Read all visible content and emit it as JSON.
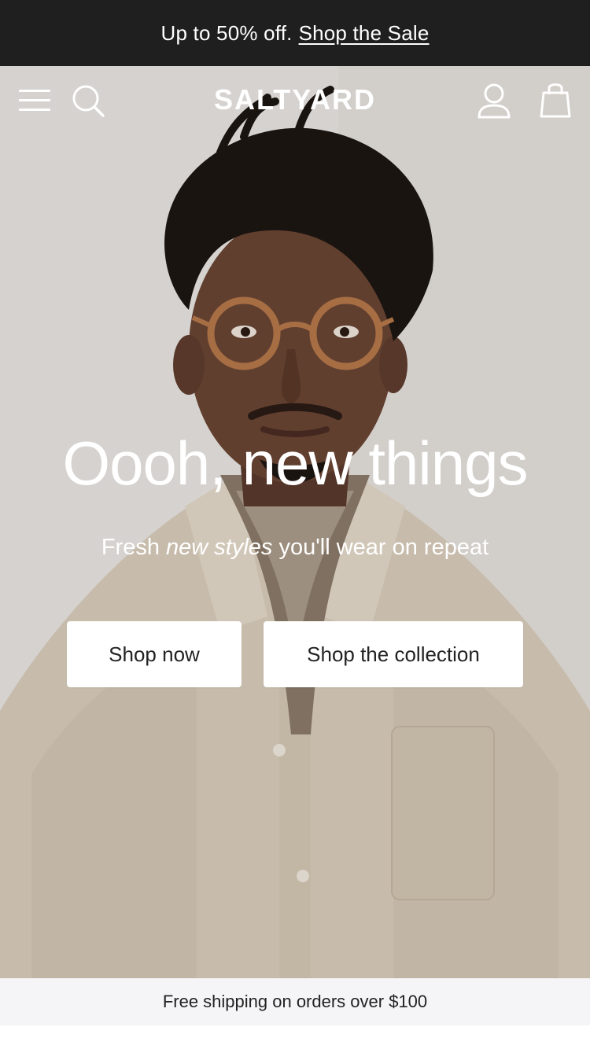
{
  "announcement": {
    "text": "Up to 50% off.",
    "link": "Shop the Sale"
  },
  "header": {
    "logo": "SALTYARD",
    "icons": [
      "menu-icon",
      "search-icon",
      "account-icon",
      "cart-icon"
    ]
  },
  "hero": {
    "headline": "Oooh, new things",
    "subline": {
      "part1": "Fresh ",
      "emphasis": "new styles",
      "part2": " you'll wear on repeat"
    },
    "buttons": {
      "shop_now": "Shop now",
      "shop_collection": "Shop the collection"
    }
  },
  "shipping_bar": {
    "text": "Free shipping on orders over $100"
  },
  "colors": {
    "announcement_bg": "#1f1f1f",
    "button_bg": "#ffffff",
    "shipping_bg": "#f5f5f7"
  }
}
